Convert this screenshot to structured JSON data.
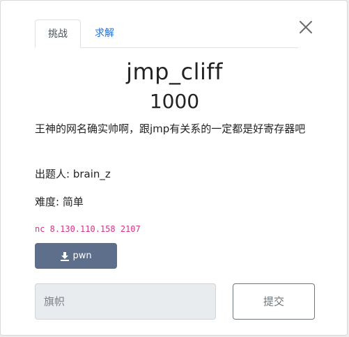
{
  "tabs": [
    {
      "label": "挑战",
      "active": true
    },
    {
      "label": "求解",
      "active": false
    }
  ],
  "challenge": {
    "title": "jmp_cliff",
    "points": "1000",
    "description": "王神的网名确实帅啊，跟jmp有关系的一定都是好寄存器吧",
    "author": "出题人: brain_z",
    "difficulty": "难度: 简单",
    "connection": "nc 8.130.110.158 2107"
  },
  "download": {
    "label": "pwn",
    "icon": "download-icon"
  },
  "flag": {
    "placeholder": "旗帜",
    "value": ""
  },
  "submit": {
    "label": "提交"
  },
  "colors": {
    "accent": "#1f6fd6",
    "download_button": "#5d6f8a",
    "code": "#d63384"
  }
}
